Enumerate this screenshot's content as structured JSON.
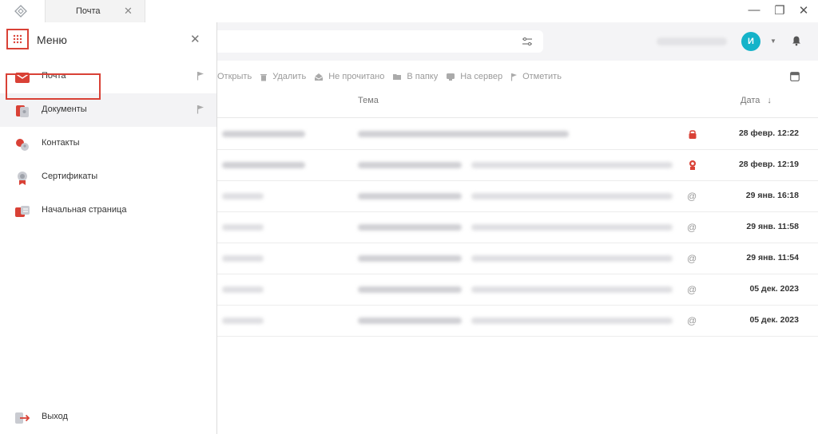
{
  "titlebar": {
    "tab_label": "Почта",
    "tab_close": "✕",
    "minimize": "—",
    "restore": "❐",
    "close": "✕"
  },
  "header": {
    "avatar_initial": "И",
    "avatar_color": "#15b3c9"
  },
  "toolbar": {
    "items": [
      {
        "label": "Открыть",
        "icon": "open-icon"
      },
      {
        "label": "Удалить",
        "icon": "trash-icon"
      },
      {
        "label": "Не прочитано",
        "icon": "envelope-open-icon"
      },
      {
        "label": "В папку",
        "icon": "folder-icon"
      },
      {
        "label": "На сервер",
        "icon": "server-upload-icon"
      },
      {
        "label": "Отметить",
        "icon": "flag-icon"
      }
    ]
  },
  "table": {
    "col_subject": "Тема",
    "col_date": "Дата",
    "sort_icon": "arrow-down-icon",
    "rows": [
      {
        "icon": "lock-icon",
        "date": "28 февр. 12:22"
      },
      {
        "icon": "certificate-icon",
        "date": "28 февр. 12:19"
      },
      {
        "icon": "at-icon",
        "date": "29 янв. 16:18"
      },
      {
        "icon": "at-icon",
        "date": "29 янв. 11:58"
      },
      {
        "icon": "at-icon",
        "date": "29 янв. 11:54"
      },
      {
        "icon": "at-icon",
        "date": "05 дек. 2023"
      },
      {
        "icon": "at-icon",
        "date": "05 дек. 2023"
      }
    ]
  },
  "menu": {
    "title": "Меню",
    "close": "✕",
    "items": [
      {
        "label": "Почта",
        "icon": "mail-icon"
      },
      {
        "label": "Документы",
        "icon": "documents-icon"
      },
      {
        "label": "Контакты",
        "icon": "contacts-icon"
      },
      {
        "label": "Сертификаты",
        "icon": "certificates-icon"
      },
      {
        "label": "Начальная страница",
        "icon": "home-page-icon"
      }
    ],
    "logout": {
      "label": "Выход",
      "icon": "logout-icon"
    }
  },
  "colors": {
    "accent_red": "#d94136",
    "avatar": "#15b3c9"
  }
}
